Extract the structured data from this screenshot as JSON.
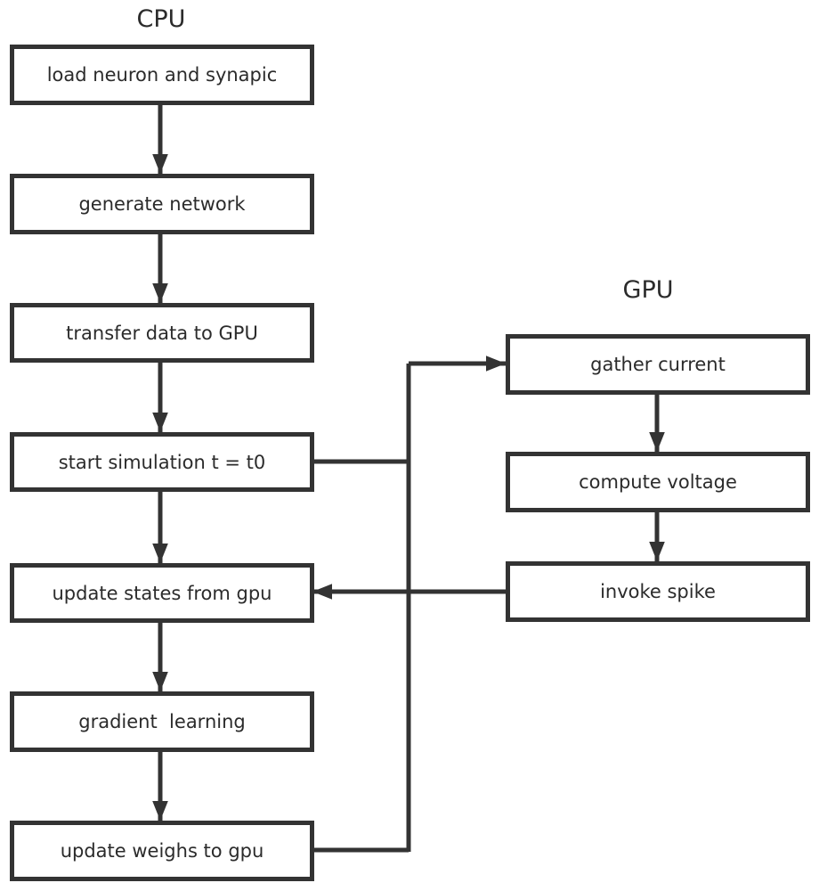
{
  "diagram": {
    "cpu_title": "CPU",
    "gpu_title": "GPU",
    "cpu_steps": [
      "load neuron and synapic",
      "generate network",
      "transfer data to GPU",
      "start simulation t = t0",
      "update states from gpu",
      "gradient  learning",
      "update weighs to gpu"
    ],
    "gpu_steps": [
      "gather current",
      "compute voltage",
      "invoke spike"
    ],
    "line_color": "#333333"
  }
}
